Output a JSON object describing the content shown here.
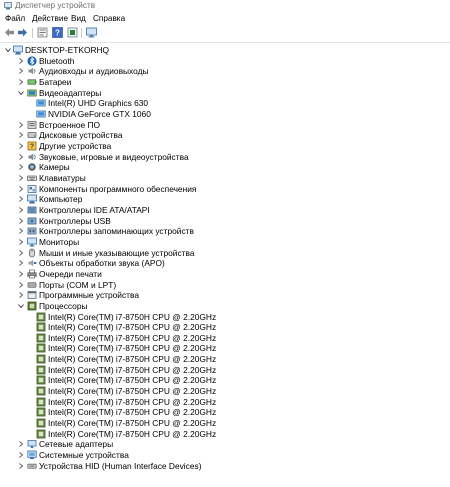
{
  "window": {
    "title": "Диспетчер устройств"
  },
  "menu": [
    "Файл",
    "Действие",
    "Вид",
    "Справка"
  ],
  "toolbar": {
    "icons": [
      "back-icon",
      "forward-icon",
      "properties-icon",
      "help-icon",
      "update-driver-icon",
      "monitor-icon"
    ]
  },
  "tree": {
    "root": "DESKTOP-ETKORHQ",
    "categories": [
      {
        "label": "Bluetooth",
        "icon": "bluetooth",
        "expanded": false,
        "children": []
      },
      {
        "label": "Аудиовходы и аудиовыходы",
        "icon": "speaker",
        "expanded": false,
        "children": []
      },
      {
        "label": "Батареи",
        "icon": "battery",
        "expanded": false,
        "children": []
      },
      {
        "label": "Видеоадаптеры",
        "icon": "display-adapter",
        "expanded": true,
        "children": [
          "Intel(R) UHD Graphics 630",
          "NVIDIA GeForce GTX 1060"
        ]
      },
      {
        "label": "Встроенное ПО",
        "icon": "firmware",
        "expanded": false,
        "children": []
      },
      {
        "label": "Дисковые устройства",
        "icon": "disk",
        "expanded": false,
        "children": []
      },
      {
        "label": "Другие устройства",
        "icon": "unknown-device",
        "expanded": false,
        "children": []
      },
      {
        "label": "Звуковые, игровые и видеоустройства",
        "icon": "sound",
        "expanded": false,
        "children": []
      },
      {
        "label": "Камеры",
        "icon": "camera",
        "expanded": false,
        "children": []
      },
      {
        "label": "Клавиатуры",
        "icon": "keyboard",
        "expanded": false,
        "children": []
      },
      {
        "label": "Компоненты программного обеспечения",
        "icon": "software-component",
        "expanded": false,
        "children": []
      },
      {
        "label": "Компьютер",
        "icon": "computer",
        "expanded": false,
        "children": []
      },
      {
        "label": "Контроллеры IDE ATA/ATAPI",
        "icon": "ide",
        "expanded": false,
        "children": []
      },
      {
        "label": "Контроллеры USB",
        "icon": "usb",
        "expanded": false,
        "children": []
      },
      {
        "label": "Контроллеры запоминающих устройств",
        "icon": "storage",
        "expanded": false,
        "children": []
      },
      {
        "label": "Мониторы",
        "icon": "monitor",
        "expanded": false,
        "children": []
      },
      {
        "label": "Мыши и иные указывающие устройства",
        "icon": "mouse",
        "expanded": false,
        "children": []
      },
      {
        "label": "Объекты обработки звука (APO)",
        "icon": "apo",
        "expanded": false,
        "children": []
      },
      {
        "label": "Очереди печати",
        "icon": "printer",
        "expanded": false,
        "children": []
      },
      {
        "label": "Порты (COM и LPT)",
        "icon": "port",
        "expanded": false,
        "children": []
      },
      {
        "label": "Программные устройства",
        "icon": "software-device",
        "expanded": false,
        "children": []
      },
      {
        "label": "Процессоры",
        "icon": "processor",
        "expanded": true,
        "children": [
          "Intel(R) Core(TM) i7-8750H CPU @ 2.20GHz",
          "Intel(R) Core(TM) i7-8750H CPU @ 2.20GHz",
          "Intel(R) Core(TM) i7-8750H CPU @ 2.20GHz",
          "Intel(R) Core(TM) i7-8750H CPU @ 2.20GHz",
          "Intel(R) Core(TM) i7-8750H CPU @ 2.20GHz",
          "Intel(R) Core(TM) i7-8750H CPU @ 2.20GHz",
          "Intel(R) Core(TM) i7-8750H CPU @ 2.20GHz",
          "Intel(R) Core(TM) i7-8750H CPU @ 2.20GHz",
          "Intel(R) Core(TM) i7-8750H CPU @ 2.20GHz",
          "Intel(R) Core(TM) i7-8750H CPU @ 2.20GHz",
          "Intel(R) Core(TM) i7-8750H CPU @ 2.20GHz",
          "Intel(R) Core(TM) i7-8750H CPU @ 2.20GHz"
        ]
      },
      {
        "label": "Сетевые адаптеры",
        "icon": "network",
        "expanded": false,
        "children": []
      },
      {
        "label": "Системные устройства",
        "icon": "system",
        "expanded": false,
        "children": []
      },
      {
        "label": "Устройства HID (Human Interface Devices)",
        "icon": "hid",
        "expanded": false,
        "children": []
      }
    ]
  }
}
